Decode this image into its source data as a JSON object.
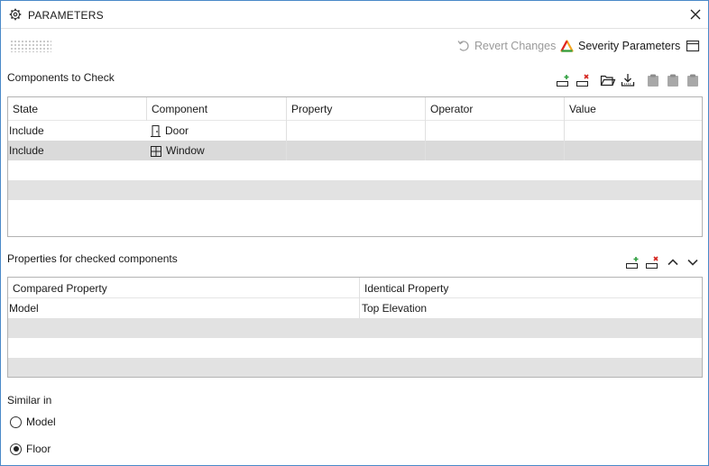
{
  "window": {
    "title": "PARAMETERS"
  },
  "toolbar": {
    "revert_label": "Revert Changes",
    "severity_label": "Severity Parameters"
  },
  "components": {
    "label": "Components to Check",
    "columns": [
      "State",
      "Component",
      "Property",
      "Operator",
      "Value"
    ],
    "rows": [
      {
        "state": "Include",
        "component": "Door",
        "icon": "door-icon",
        "property": "",
        "operator": "",
        "value": ""
      },
      {
        "state": "Include",
        "component": "Window",
        "icon": "window-icon",
        "property": "",
        "operator": "",
        "value": ""
      }
    ]
  },
  "properties": {
    "label": "Properties for checked components",
    "columns": [
      "Compared Property",
      "Identical Property"
    ],
    "rows": [
      {
        "compared": "Model",
        "identical": "Top Elevation"
      }
    ]
  },
  "similar": {
    "label": "Similar in",
    "options": [
      {
        "label": "Model",
        "selected": false
      },
      {
        "label": "Floor",
        "selected": true
      }
    ]
  },
  "colors": {
    "accent_border": "#4a89c8",
    "add_green": "#2e9e3e",
    "remove_red": "#d4231c"
  }
}
